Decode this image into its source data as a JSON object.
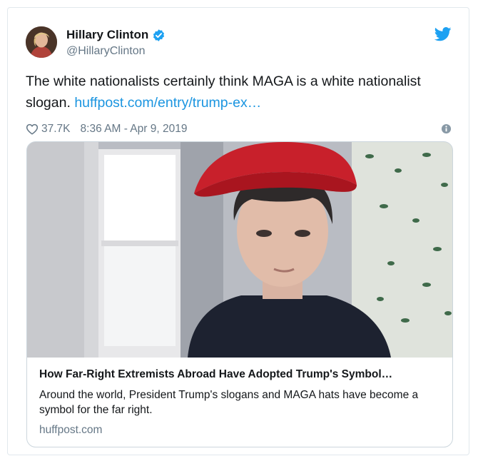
{
  "tweet": {
    "display_name": "Hillary Clinton",
    "handle": "@HillaryClinton",
    "text": "The white nationalists certainly think MAGA is a white nationalist slogan.",
    "link_text": "huffpost.com/entry/trump-ex…",
    "likes": "37.7K",
    "timestamp": "8:36 AM - Apr 9, 2019"
  },
  "card": {
    "title": "How Far-Right Extremists Abroad Have Adopted Trump's Symbol…",
    "description": "Around the world, President Trump's slogans and MAGA hats have become a symbol for the far right.",
    "domain": "huffpost.com"
  },
  "icons": {
    "verified": "verified-badge-icon",
    "bird": "twitter-bird-icon",
    "heart": "heart-icon",
    "info": "info-icon"
  },
  "colors": {
    "link": "#1b95e0",
    "secondary_text": "#657786",
    "border": "#e1e8ed",
    "twitter_blue": "#1da1f2",
    "hat_red": "#c8202b"
  }
}
